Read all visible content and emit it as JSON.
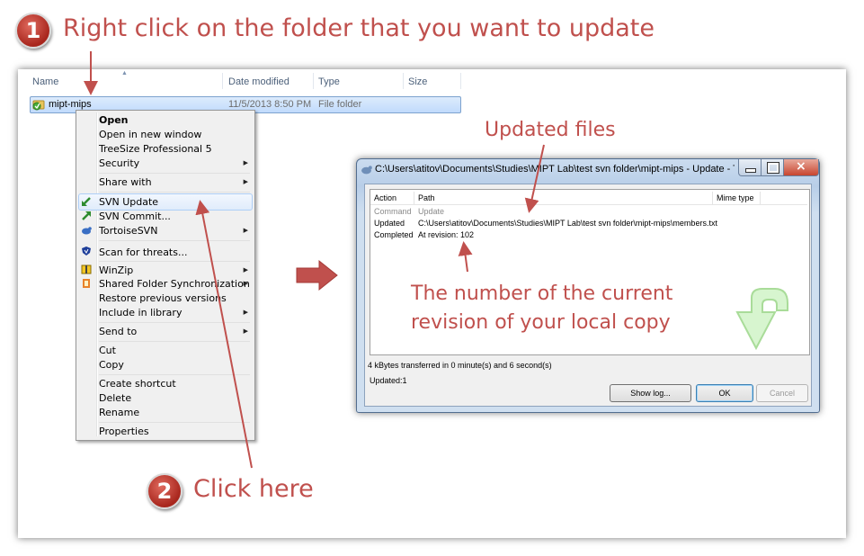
{
  "callouts": {
    "step1_number": "1",
    "step1_text": "Right click on the folder that you want to update",
    "step2_number": "2",
    "step2_text": "Click here",
    "updated_files": "Updated files",
    "revision_line1": "The number of the current",
    "revision_line2": "revision of your local copy"
  },
  "explorer": {
    "columns": [
      "Name",
      "Date modified",
      "Type",
      "Size"
    ],
    "row": {
      "name": "mipt-mips",
      "date": "11/5/2013 8:50 PM",
      "type": "File folder",
      "size": ""
    }
  },
  "context_menu": {
    "items": [
      {
        "label": "Open",
        "bold": true
      },
      {
        "label": "Open in new window"
      },
      {
        "label": "TreeSize Professional 5"
      },
      {
        "label": "Security",
        "submenu": true
      },
      {
        "label": "Share with",
        "submenu": true
      },
      {
        "label": "SVN Update",
        "icon": "svn-update-icon",
        "highlighted": true
      },
      {
        "label": "SVN Commit...",
        "icon": "svn-commit-icon"
      },
      {
        "label": "TortoiseSVN",
        "icon": "tortoise-icon",
        "submenu": true
      },
      {
        "label": "Scan for threats...",
        "icon": "shield-icon"
      },
      {
        "label": "WinZip",
        "icon": "winzip-icon",
        "submenu": true
      },
      {
        "label": "Shared Folder Synchronization",
        "icon": "sync-icon",
        "submenu": true
      },
      {
        "label": "Restore previous versions"
      },
      {
        "label": "Include in library",
        "submenu": true
      },
      {
        "label": "Send to",
        "submenu": true
      },
      {
        "label": "Cut"
      },
      {
        "label": "Copy"
      },
      {
        "label": "Create shortcut"
      },
      {
        "label": "Delete"
      },
      {
        "label": "Rename"
      },
      {
        "label": "Properties"
      }
    ]
  },
  "dialog": {
    "title": "C:\\Users\\atitov\\Documents\\Studies\\MIPT Lab\\test svn folder\\mipt-mips - Update - Tortoise...",
    "columns": [
      "Action",
      "Path",
      "Mime type"
    ],
    "rows": [
      {
        "action": "Command",
        "path": "Update",
        "muted": true
      },
      {
        "action": "Updated",
        "path": "C:\\Users\\atitov\\Documents\\Studies\\MIPT Lab\\test svn folder\\mipt-mips\\members.txt"
      },
      {
        "action": "Completed",
        "path": "At revision: 102"
      }
    ],
    "transfer_info": "4 kBytes transferred in 0 minute(s) and 6 second(s)",
    "summary": "Updated:1",
    "buttons": {
      "show_log": "Show log...",
      "ok": "OK",
      "cancel": "Cancel"
    }
  },
  "colors": {
    "accent": "#c0504d",
    "selection": "#cde6f7"
  }
}
